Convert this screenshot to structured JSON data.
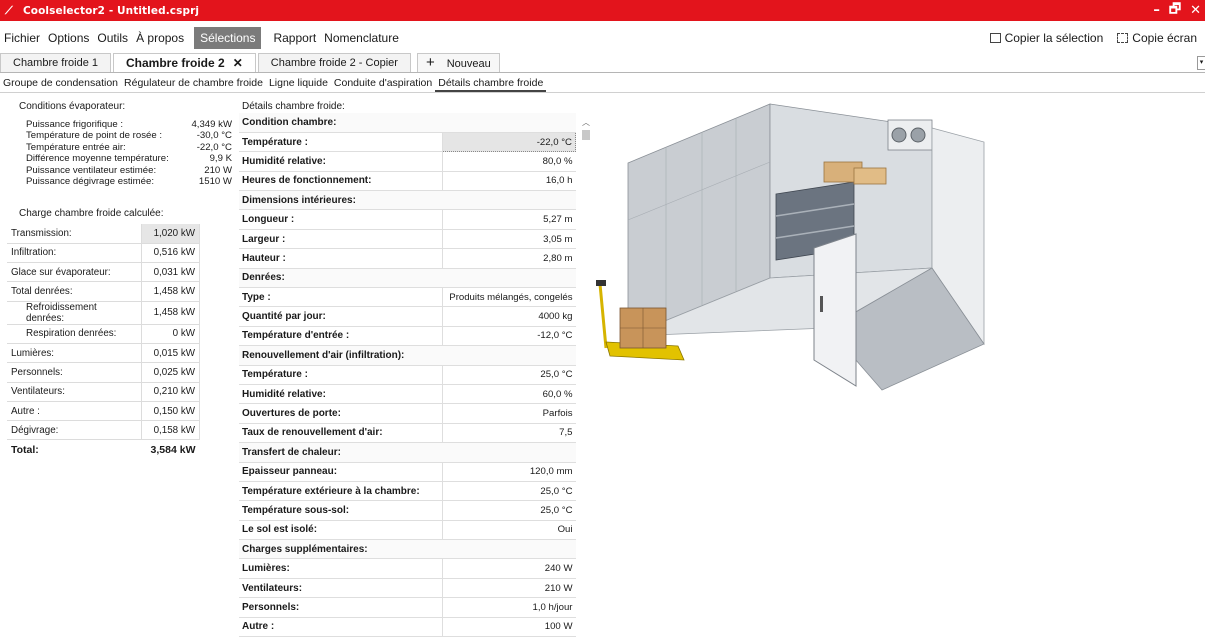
{
  "window": {
    "title": "Coolselector2 - Untitled.csprj",
    "controls": [
      "–",
      "🗗",
      "✕"
    ]
  },
  "menu": {
    "items": [
      "Fichier",
      "Options",
      "Outils",
      "À propos"
    ],
    "active": "Sélections",
    "after": [
      "Rapport",
      "Nomenclature"
    ],
    "copy_selection": "Copier la sélection",
    "copy_screen": "Copie écran"
  },
  "doc_tabs": {
    "tab1": "Chambre froide 1",
    "tab2": "Chambre froide 2",
    "tab3": "Chambre froide 2 - Copier",
    "new_tab": "Nouveau"
  },
  "sub_tabs": [
    "Groupe de condensation",
    "Régulateur de chambre froide",
    "Ligne liquide",
    "Conduite d'aspiration",
    "Détails chambre froide"
  ],
  "evaporator": {
    "heading": "Conditions évaporateur:",
    "rows": [
      {
        "label": "Puissance frigorifique :",
        "value": "4,349 kW"
      },
      {
        "label": "Température de point de rosée :",
        "value": "-30,0 °C"
      },
      {
        "label": "Température entrée air:",
        "value": "-22,0 °C"
      },
      {
        "label": "Différence moyenne température:",
        "value": "9,9 K"
      },
      {
        "label": "Puissance ventilateur estimée:",
        "value": "210 W"
      },
      {
        "label": "Puissance dégivrage estimée:",
        "value": "1510 W"
      }
    ]
  },
  "load": {
    "heading": "Charge chambre froide calculée:",
    "rows": [
      {
        "label": "Transmission:",
        "value": "1,020 kW"
      },
      {
        "label": "Infiltration:",
        "value": "0,516 kW"
      },
      {
        "label": "Glace sur évaporateur:",
        "value": "0,031 kW"
      },
      {
        "label": "Total denrées:",
        "value": "1,458 kW"
      },
      {
        "label": "Refroidissement denrées:",
        "value": "1,458 kW"
      },
      {
        "label": "Respiration denrées:",
        "value": "0 kW"
      },
      {
        "label": "Lumières:",
        "value": "0,015 kW"
      },
      {
        "label": "Personnels:",
        "value": "0,025 kW"
      },
      {
        "label": "Ventilateurs:",
        "value": "0,210 kW"
      },
      {
        "label": "Autre :",
        "value": "0,150 kW"
      },
      {
        "label": "Dégivrage:",
        "value": "0,158 kW"
      },
      {
        "label": "Total:",
        "value": "3,584 kW"
      }
    ]
  },
  "details": {
    "heading": "Détails chambre froide:",
    "rows": [
      {
        "label": "Condition chambre:",
        "value": ""
      },
      {
        "label": "Température :",
        "value": "-22,0 °C"
      },
      {
        "label": "Humidité relative:",
        "value": "80,0 %"
      },
      {
        "label": "Heures de fonctionnement:",
        "value": "16,0 h"
      },
      {
        "label": "Dimensions intérieures:",
        "value": ""
      },
      {
        "label": "Longueur :",
        "value": "5,27 m"
      },
      {
        "label": "Largeur :",
        "value": "3,05 m"
      },
      {
        "label": "Hauteur :",
        "value": "2,80 m"
      },
      {
        "label": "Denrées:",
        "value": ""
      },
      {
        "label": "Type :",
        "value": "Produits mélangés, congelés"
      },
      {
        "label": "Quantité par jour:",
        "value": "4000 kg"
      },
      {
        "label": "Température d'entrée :",
        "value": "-12,0 °C"
      },
      {
        "label": "Renouvellement d'air (infiltration):",
        "value": ""
      },
      {
        "label": "Température :",
        "value": "25,0 °C"
      },
      {
        "label": "Humidité relative:",
        "value": "60,0 %"
      },
      {
        "label": "Ouvertures de porte:",
        "value": "Parfois"
      },
      {
        "label": "Taux de renouvellement d'air:",
        "value": "7,5"
      },
      {
        "label": "Transfert de chaleur:",
        "value": ""
      },
      {
        "label": "Epaisseur panneau:",
        "value": "120,0 mm"
      },
      {
        "label": "Température extérieure à la chambre:",
        "value": "25,0 °C"
      },
      {
        "label": "Température sous-sol:",
        "value": "25,0 °C"
      },
      {
        "label": "Le sol est isolé:",
        "value": "Oui"
      },
      {
        "label": "Charges supplémentaires:",
        "value": ""
      },
      {
        "label": "Lumières:",
        "value": "240 W"
      },
      {
        "label": "Ventilateurs:",
        "value": "210 W"
      },
      {
        "label": "Personnels:",
        "value": "1,0 h/jour"
      },
      {
        "label": "Autre :",
        "value": "100 W"
      }
    ]
  },
  "colors": {
    "titlebar": "#e3141c",
    "active_menu": "#7b7b7b"
  }
}
